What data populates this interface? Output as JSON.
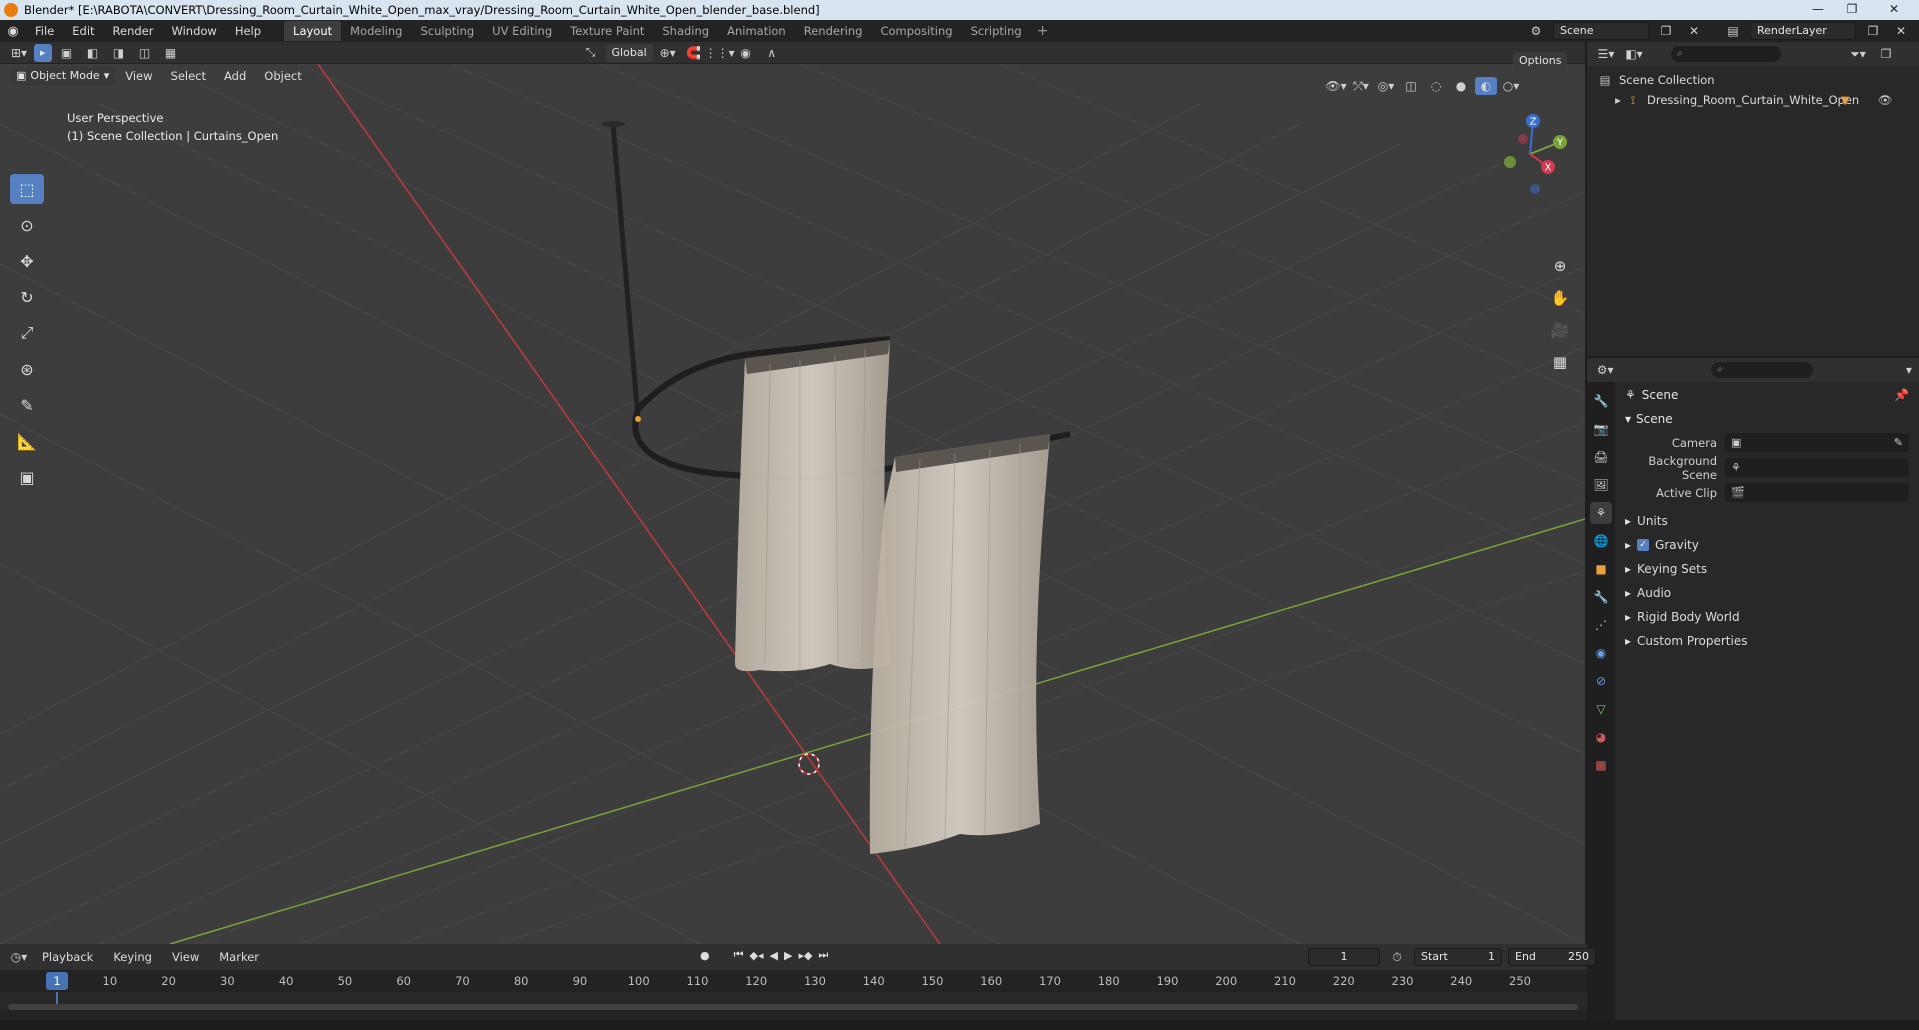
{
  "window": {
    "title": "Blender* [E:\\RABOTA\\CONVERT\\Dressing_Room_Curtain_White_Open_max_vray/Dressing_Room_Curtain_White_Open_blender_base.blend]"
  },
  "menu": [
    "File",
    "Edit",
    "Render",
    "Window",
    "Help"
  ],
  "workspaces": [
    "Layout",
    "Modeling",
    "Sculpting",
    "UV Editing",
    "Texture Paint",
    "Shading",
    "Animation",
    "Rendering",
    "Compositing",
    "Scripting"
  ],
  "active_workspace": "Layout",
  "scene_field": "Scene",
  "renderlayer_field": "RenderLayer",
  "viewport": {
    "transform_orientation": "Global",
    "options_label": "Options",
    "mode": "Object Mode",
    "menus": [
      "View",
      "Select",
      "Add",
      "Object"
    ],
    "info_line1": "User Perspective",
    "info_line2": "(1) Scene Collection | Curtains_Open",
    "gizmo_axes": {
      "x": "X",
      "y": "Y",
      "z": "Z"
    }
  },
  "outliner": {
    "root": "Scene Collection",
    "items": [
      "Dressing_Room_Curtain_White_Open"
    ]
  },
  "properties": {
    "context": "Scene",
    "panel": "Scene",
    "fields": [
      {
        "label": "Camera",
        "value": ""
      },
      {
        "label": "Background Scene",
        "value": ""
      },
      {
        "label": "Active Clip",
        "value": ""
      }
    ],
    "subpanels": [
      {
        "label": "Units",
        "checkbox": false
      },
      {
        "label": "Gravity",
        "checkbox": true
      },
      {
        "label": "Keying Sets",
        "checkbox": false
      },
      {
        "label": "Audio",
        "checkbox": false
      },
      {
        "label": "Rigid Body World",
        "checkbox": false
      },
      {
        "label": "Custom Properties",
        "checkbox": false
      }
    ]
  },
  "timeline": {
    "menus": [
      "Playback",
      "Keying",
      "View",
      "Marker"
    ],
    "current_frame": "1",
    "start_label": "Start",
    "start": "1",
    "end_label": "End",
    "end": "250",
    "ruler": [
      "1",
      "10",
      "20",
      "30",
      "40",
      "50",
      "60",
      "70",
      "80",
      "90",
      "100",
      "110",
      "120",
      "130",
      "140",
      "150",
      "160",
      "170",
      "180",
      "190",
      "200",
      "210",
      "220",
      "230",
      "240",
      "250"
    ]
  },
  "colors": {
    "accent": "#5680c2",
    "x_axis": "#c23a3a",
    "y_axis": "#7aa23a",
    "curtain": "#cfc7bb"
  }
}
